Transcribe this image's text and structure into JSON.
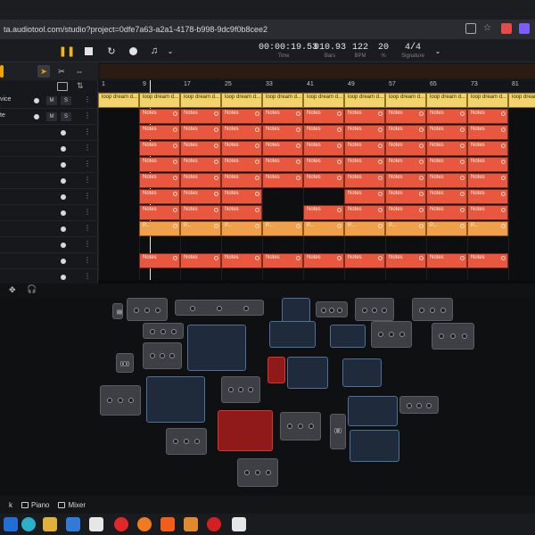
{
  "browser": {
    "url": "ta.audiotool.com/studio?project=0dfe7a63-a2a1-4178-b998-9dc9f0b8cee2"
  },
  "transport": {
    "time": "00:00:19.53",
    "time_label": "Time",
    "bars": "010.93",
    "bars_label": "Bars",
    "bpm": "122",
    "bpm_label": "BPM",
    "percent": "20",
    "percent_label": "%",
    "signature": "4/4",
    "signature_label": "Signature"
  },
  "ruler": [
    "1",
    "9",
    "17",
    "25",
    "33",
    "41",
    "49",
    "57",
    "65",
    "73",
    "81"
  ],
  "tracks": [
    {
      "name": "vice",
      "has_ms": true
    },
    {
      "name": "te",
      "has_ms": true
    },
    {
      "name": "",
      "has_ms": false
    },
    {
      "name": "",
      "has_ms": false
    },
    {
      "name": "",
      "has_ms": false
    },
    {
      "name": "",
      "has_ms": false
    },
    {
      "name": "",
      "has_ms": false
    },
    {
      "name": "",
      "has_ms": false
    },
    {
      "name": "",
      "has_ms": false
    },
    {
      "name": "",
      "has_ms": false
    },
    {
      "name": "",
      "has_ms": false
    },
    {
      "name": "",
      "has_ms": false
    }
  ],
  "mute_label": "M",
  "solo_label": "S",
  "clips": {
    "loop_label": "loop dream d...",
    "notes_label": "Notes",
    "orange_label": "P..."
  },
  "bottom_tabs": [
    {
      "label": "k"
    },
    {
      "label": "Piano"
    },
    {
      "label": "Mixer"
    }
  ],
  "colors": {
    "notes_clip": "#e9573f",
    "loop_clip": "#f3d36b",
    "orange_clip": "#f0a04a",
    "accent": "#f0a500"
  }
}
